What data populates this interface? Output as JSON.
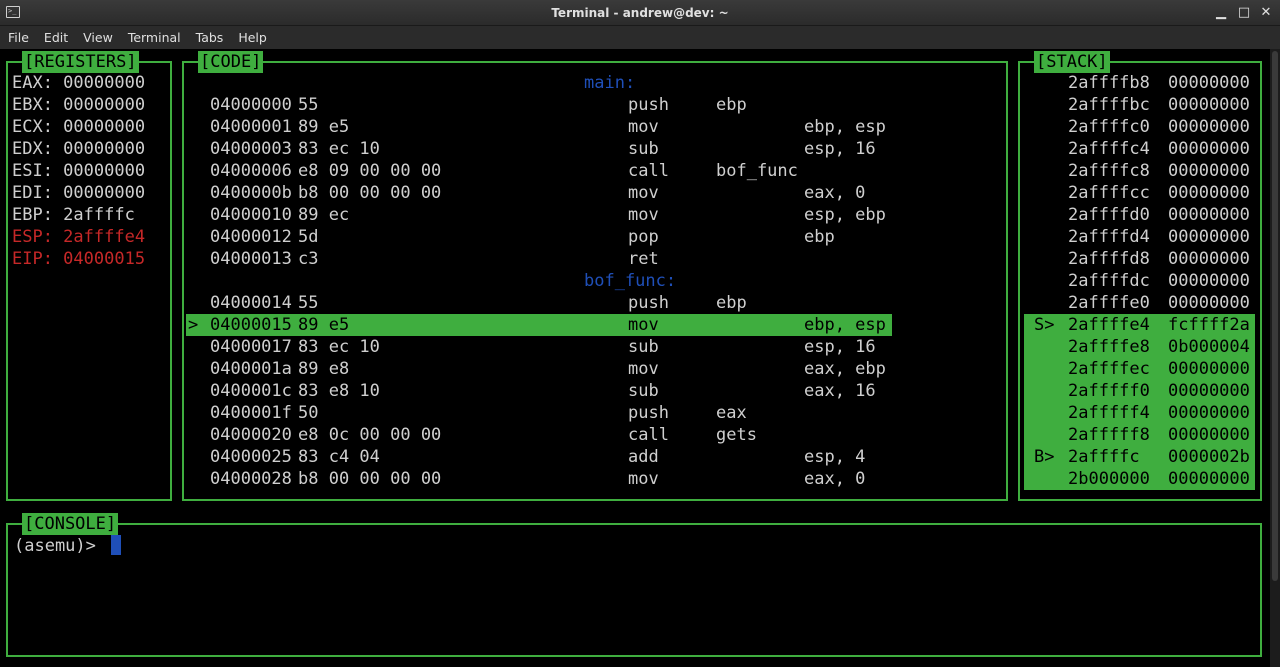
{
  "window": {
    "title": "Terminal - andrew@dev: ~",
    "minimize": "▁",
    "maximize": "□",
    "close": "✕"
  },
  "menu": [
    "File",
    "Edit",
    "View",
    "Terminal",
    "Tabs",
    "Help"
  ],
  "panels": {
    "registers": "[REGISTERS]",
    "code": "[CODE]",
    "stack": "[STACK]",
    "console": "[CONSOLE]"
  },
  "registers": [
    {
      "text": "EAX: 00000000",
      "changed": false
    },
    {
      "text": "EBX: 00000000",
      "changed": false
    },
    {
      "text": "ECX: 00000000",
      "changed": false
    },
    {
      "text": "EDX: 00000000",
      "changed": false
    },
    {
      "text": "ESI: 00000000",
      "changed": false
    },
    {
      "text": "EDI: 00000000",
      "changed": false
    },
    {
      "text": "EBP: 2affffc",
      "changed": false
    },
    {
      "text": "ESP: 2affffe4",
      "changed": true
    },
    {
      "text": "EIP: 04000015",
      "changed": true
    }
  ],
  "code": [
    {
      "label": "main:"
    },
    {
      "addr": "04000000",
      "bytes": "55",
      "mnem": "push",
      "ops": "ebp",
      "opcol": 1
    },
    {
      "addr": "04000001",
      "bytes": "89 e5",
      "mnem": "mov",
      "ops": "ebp, esp",
      "opcol": 2
    },
    {
      "addr": "04000003",
      "bytes": "83 ec 10",
      "mnem": "sub",
      "ops": "esp, 16",
      "opcol": 2
    },
    {
      "addr": "04000006",
      "bytes": "e8 09 00 00 00",
      "mnem": "call",
      "ops": "bof_func",
      "opcol": 1
    },
    {
      "addr": "0400000b",
      "bytes": "b8 00 00 00 00",
      "mnem": "mov",
      "ops": "eax, 0",
      "opcol": 2
    },
    {
      "addr": "04000010",
      "bytes": "89 ec",
      "mnem": "mov",
      "ops": "esp, ebp",
      "opcol": 2
    },
    {
      "addr": "04000012",
      "bytes": "5d",
      "mnem": "pop",
      "ops": "ebp",
      "opcol": 2
    },
    {
      "addr": "04000013",
      "bytes": "c3",
      "mnem": "ret",
      "ops": "",
      "opcol": 1
    },
    {
      "label": "bof_func:"
    },
    {
      "addr": "04000014",
      "bytes": "55",
      "mnem": "push",
      "ops": "ebp",
      "opcol": 1
    },
    {
      "addr": "04000015",
      "bytes": "89 e5",
      "mnem": "mov",
      "ops": "ebp, esp",
      "opcol": 2,
      "current": true
    },
    {
      "addr": "04000017",
      "bytes": "83 ec 10",
      "mnem": "sub",
      "ops": "esp, 16",
      "opcol": 2
    },
    {
      "addr": "0400001a",
      "bytes": "89 e8",
      "mnem": "mov",
      "ops": "eax, ebp",
      "opcol": 2
    },
    {
      "addr": "0400001c",
      "bytes": "83 e8 10",
      "mnem": "sub",
      "ops": "eax, 16",
      "opcol": 2
    },
    {
      "addr": "0400001f",
      "bytes": "50",
      "mnem": "push",
      "ops": "eax",
      "opcol": 1
    },
    {
      "addr": "04000020",
      "bytes": "e8 0c 00 00 00",
      "mnem": "call",
      "ops": "gets",
      "opcol": 1
    },
    {
      "addr": "04000025",
      "bytes": "83 c4 04",
      "mnem": "add",
      "ops": "esp, 4",
      "opcol": 2
    },
    {
      "addr": "04000028",
      "bytes": "b8 00 00 00 00",
      "mnem": "mov",
      "ops": "eax, 0",
      "opcol": 2
    }
  ],
  "current_marker": ">",
  "stack": [
    {
      "marker": "",
      "addr": "2affffb8",
      "val": "00000000",
      "hl": false
    },
    {
      "marker": "",
      "addr": "2affffbc",
      "val": "00000000",
      "hl": false
    },
    {
      "marker": "",
      "addr": "2affffc0",
      "val": "00000000",
      "hl": false
    },
    {
      "marker": "",
      "addr": "2affffc4",
      "val": "00000000",
      "hl": false
    },
    {
      "marker": "",
      "addr": "2affffc8",
      "val": "00000000",
      "hl": false
    },
    {
      "marker": "",
      "addr": "2affffcc",
      "val": "00000000",
      "hl": false
    },
    {
      "marker": "",
      "addr": "2affffd0",
      "val": "00000000",
      "hl": false
    },
    {
      "marker": "",
      "addr": "2affffd4",
      "val": "00000000",
      "hl": false
    },
    {
      "marker": "",
      "addr": "2affffd8",
      "val": "00000000",
      "hl": false
    },
    {
      "marker": "",
      "addr": "2affffdc",
      "val": "00000000",
      "hl": false
    },
    {
      "marker": "",
      "addr": "2affffe0",
      "val": "00000000",
      "hl": false
    },
    {
      "marker": "S>",
      "addr": "2affffe4",
      "val": "fcffff2a",
      "hl": true
    },
    {
      "marker": "",
      "addr": "2affffe8",
      "val": "0b000004",
      "hl": true
    },
    {
      "marker": "",
      "addr": "2affffec",
      "val": "00000000",
      "hl": true
    },
    {
      "marker": "",
      "addr": "2afffff0",
      "val": "00000000",
      "hl": true
    },
    {
      "marker": "",
      "addr": "2afffff4",
      "val": "00000000",
      "hl": true
    },
    {
      "marker": "",
      "addr": "2afffff8",
      "val": "00000000",
      "hl": true
    },
    {
      "marker": "B>",
      "addr": "2affffc",
      "val": "0000002b",
      "hl": true
    },
    {
      "marker": "",
      "addr": "2b000000",
      "val": "00000000",
      "hl": true
    }
  ],
  "console": {
    "prompt": "(asemu)> "
  },
  "colors": {
    "accent": "#3fae3f",
    "changed": "#c62828",
    "label": "#1f4fb8"
  }
}
